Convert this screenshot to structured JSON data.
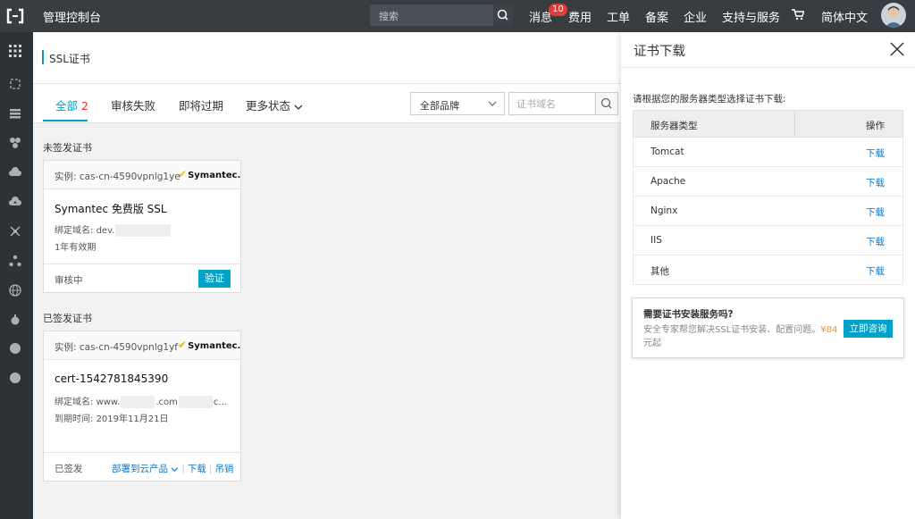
{
  "topbar": {
    "console_title": "管理控制台",
    "search_placeholder": "搜索",
    "messages_label": "消息",
    "messages_badge": "10",
    "nav_items": [
      "费用",
      "工单",
      "备案",
      "企业",
      "支持与服务"
    ],
    "language": "简体中文"
  },
  "page": {
    "title": "SSL证书",
    "tabs": [
      {
        "label": "全部",
        "count": "2"
      },
      {
        "label": "审核失败"
      },
      {
        "label": "即将过期"
      },
      {
        "label": "更多状态"
      }
    ],
    "brand_filter": "全部品牌",
    "domain_placeholder": "证书域名"
  },
  "unissued": {
    "section_label": "未签发证书",
    "card": {
      "instance": "实例: cas-cn-4590vpnlg1ye",
      "brand": "Symantec.",
      "name": "Symantec 免费版 SSL",
      "domain_label": "绑定域名:",
      "domain_prefix": "dev.",
      "validity": "1年有效期",
      "status": "审核中",
      "verify_label": "验证"
    }
  },
  "issued": {
    "section_label": "已签发证书",
    "card": {
      "instance": "实例: cas-cn-4590vpnlg1yf",
      "brand": "Symantec.",
      "name": "cert-1542781845390",
      "domain_label": "绑定域名:",
      "domain_part1": "www.",
      "domain_part2": ".com",
      "domain_part3": "c...",
      "expiry_label": "到期时间:",
      "expiry_date": "2019年11月21日",
      "status": "已签发",
      "deploy_label": "部署到云产品",
      "download_label": "下载",
      "revoke_label": "吊销"
    }
  },
  "drawer": {
    "title": "证书下载",
    "hint": "请根据您的服务器类型选择证书下载:",
    "col_server": "服务器类型",
    "col_action": "操作",
    "rows": [
      {
        "server": "Tomcat",
        "action": "下载"
      },
      {
        "server": "Apache",
        "action": "下载"
      },
      {
        "server": "Nginx",
        "action": "下载"
      },
      {
        "server": "IIS",
        "action": "下载"
      },
      {
        "server": "其他",
        "action": "下载"
      }
    ],
    "promo": {
      "title": "需要证书安装服务吗?",
      "desc": "安全专家帮您解决SSL证书安装、配置问题。",
      "price": "¥84",
      "suffix": "元起",
      "button": "立即咨询"
    }
  },
  "colors": {
    "accent": "#00a2ca",
    "link": "#0e78c8",
    "badge": "#e03c3c",
    "price": "#f39800",
    "topbar": "#373d41",
    "sidebar": "#2d3236"
  }
}
